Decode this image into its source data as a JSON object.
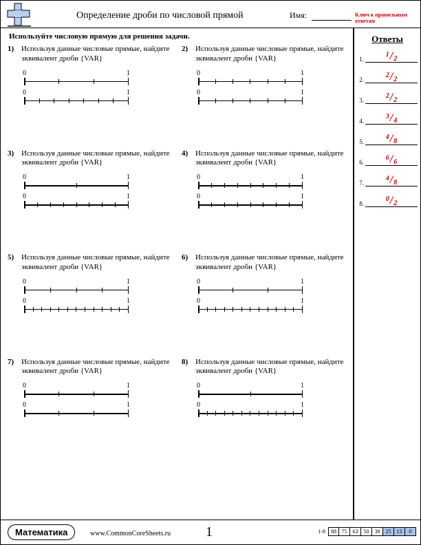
{
  "header": {
    "title": "Определение дроби по числовой прямой",
    "name_label": "Имя:",
    "key_label": "Ключ к правильным ответам"
  },
  "instruction": "Используйте числовую прямую для решения задачи.",
  "problem_text": "Используя данные числовые прямые, найдите эквивалент дроби {VAR}",
  "label_zero": "0",
  "label_one": "1",
  "problems": [
    {
      "num": "1)",
      "top_ticks": 4,
      "bot_ticks": 8
    },
    {
      "num": "2)",
      "top_ticks": 7,
      "bot_ticks": 7
    },
    {
      "num": "3)",
      "top_ticks": 3,
      "bot_ticks": 9
    },
    {
      "num": "4)",
      "top_ticks": 9,
      "bot_ticks": 9
    },
    {
      "num": "5)",
      "top_ticks": 5,
      "bot_ticks": 13
    },
    {
      "num": "6)",
      "top_ticks": 4,
      "bot_ticks": 13
    },
    {
      "num": "7)",
      "top_ticks": 4,
      "bot_ticks": 4
    },
    {
      "num": "8)",
      "top_ticks": 3,
      "bot_ticks": 13
    }
  ],
  "answers": {
    "heading": "Ответы",
    "items": [
      {
        "num": "1.",
        "n": "1",
        "d": "2"
      },
      {
        "num": "2.",
        "n": "2",
        "d": "2"
      },
      {
        "num": "3.",
        "n": "2",
        "d": "2"
      },
      {
        "num": "4.",
        "n": "3",
        "d": "4"
      },
      {
        "num": "5.",
        "n": "4",
        "d": "8"
      },
      {
        "num": "6.",
        "n": "6",
        "d": "6"
      },
      {
        "num": "7.",
        "n": "4",
        "d": "8"
      },
      {
        "num": "8.",
        "n": "0",
        "d": "2"
      }
    ]
  },
  "footer": {
    "subject": "Математика",
    "url": "www.CommonCoreSheets.ru",
    "page": "1",
    "range": "1-8",
    "scores": [
      "88",
      "75",
      "63",
      "50",
      "38",
      "25",
      "13",
      "0"
    ],
    "score_colors": [
      "#fff",
      "#fff",
      "#fff",
      "#fff",
      "#fff",
      "#a7c4e8",
      "#a7c4e8",
      "#a7c4e8"
    ]
  }
}
